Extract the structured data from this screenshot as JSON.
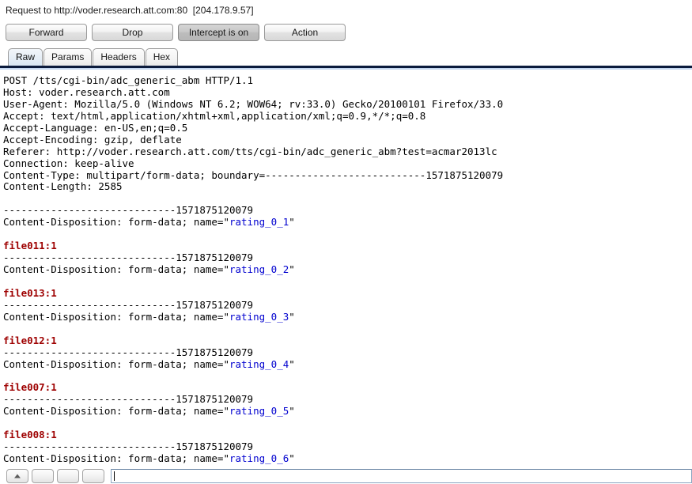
{
  "titlebar": {
    "text": "Request to http://voder.research.att.com:80  [204.178.9.57]"
  },
  "actions": {
    "buttons": [
      {
        "label": "Forward",
        "name": "forward-button",
        "toggled": false
      },
      {
        "label": "Drop",
        "name": "drop-button",
        "toggled": false
      },
      {
        "label": "Intercept is on",
        "name": "intercept-toggle-button",
        "toggled": true
      },
      {
        "label": "Action",
        "name": "action-button",
        "toggled": false
      }
    ]
  },
  "tabs": {
    "items": [
      {
        "label": "Raw",
        "name": "tab-raw",
        "active": true
      },
      {
        "label": "Params",
        "name": "tab-params",
        "active": false
      },
      {
        "label": "Headers",
        "name": "tab-headers",
        "active": false
      },
      {
        "label": "Hex",
        "name": "tab-hex",
        "active": false
      }
    ]
  },
  "message": {
    "lines": [
      [
        {
          "t": "POST /tts/cgi-bin/adc_generic_abm HTTP/1.1"
        }
      ],
      [
        {
          "t": "Host: voder.research.att.com"
        }
      ],
      [
        {
          "t": "User-Agent: Mozilla/5.0 (Windows NT 6.2; WOW64; rv:33.0) Gecko/20100101 Firefox/33.0"
        }
      ],
      [
        {
          "t": "Accept: text/html,application/xhtml+xml,application/xml;q=0.9,*/*;q=0.8"
        }
      ],
      [
        {
          "t": "Accept-Language: en-US,en;q=0.5"
        }
      ],
      [
        {
          "t": "Accept-Encoding: gzip, deflate"
        }
      ],
      [
        {
          "t": "Referer: http://voder.research.att.com/tts/cgi-bin/adc_generic_abm?test=acmar2013lc"
        }
      ],
      [
        {
          "t": "Connection: keep-alive"
        }
      ],
      [
        {
          "t": "Content-Type: multipart/form-data; boundary=---------------------------1571875120079"
        }
      ],
      [
        {
          "t": "Content-Length: 2585"
        }
      ],
      [
        {
          "t": ""
        }
      ],
      [
        {
          "t": "-----------------------------1571875120079"
        }
      ],
      [
        {
          "t": "Content-Disposition: form-data; name=\""
        },
        {
          "t": "rating_0_1",
          "c": "name"
        },
        {
          "t": "\""
        }
      ],
      [
        {
          "t": ""
        }
      ],
      [
        {
          "t": "file011:1",
          "c": "value"
        }
      ],
      [
        {
          "t": "-----------------------------1571875120079"
        }
      ],
      [
        {
          "t": "Content-Disposition: form-data; name=\""
        },
        {
          "t": "rating_0_2",
          "c": "name"
        },
        {
          "t": "\""
        }
      ],
      [
        {
          "t": ""
        }
      ],
      [
        {
          "t": "file013:1",
          "c": "value"
        }
      ],
      [
        {
          "t": "-----------------------------1571875120079"
        }
      ],
      [
        {
          "t": "Content-Disposition: form-data; name=\""
        },
        {
          "t": "rating_0_3",
          "c": "name"
        },
        {
          "t": "\""
        }
      ],
      [
        {
          "t": ""
        }
      ],
      [
        {
          "t": "file012:1",
          "c": "value"
        }
      ],
      [
        {
          "t": "-----------------------------1571875120079"
        }
      ],
      [
        {
          "t": "Content-Disposition: form-data; name=\""
        },
        {
          "t": "rating_0_4",
          "c": "name"
        },
        {
          "t": "\""
        }
      ],
      [
        {
          "t": ""
        }
      ],
      [
        {
          "t": "file007:1",
          "c": "value"
        }
      ],
      [
        {
          "t": "-----------------------------1571875120079"
        }
      ],
      [
        {
          "t": "Content-Disposition: form-data; name=\""
        },
        {
          "t": "rating_0_5",
          "c": "name"
        },
        {
          "t": "\""
        }
      ],
      [
        {
          "t": ""
        }
      ],
      [
        {
          "t": "file008:1",
          "c": "value"
        }
      ],
      [
        {
          "t": "-----------------------------1571875120079"
        }
      ],
      [
        {
          "t": "Content-Disposition: form-data; name=\""
        },
        {
          "t": "rating_0_6",
          "c": "name"
        },
        {
          "t": "\""
        }
      ]
    ]
  },
  "searchbar": {
    "buttons": [
      {
        "name": "search-prev-button",
        "icon": "caret-up-icon"
      },
      {
        "name": "search-next-button",
        "icon": ""
      },
      {
        "name": "search-option-button",
        "icon": ""
      },
      {
        "name": "search-close-button",
        "icon": ""
      }
    ],
    "input_value": "",
    "input_placeholder": ""
  },
  "colors": {
    "param_name": "#0000cf",
    "param_value": "#9e0000",
    "tab_rule": "#0b1b3d"
  }
}
